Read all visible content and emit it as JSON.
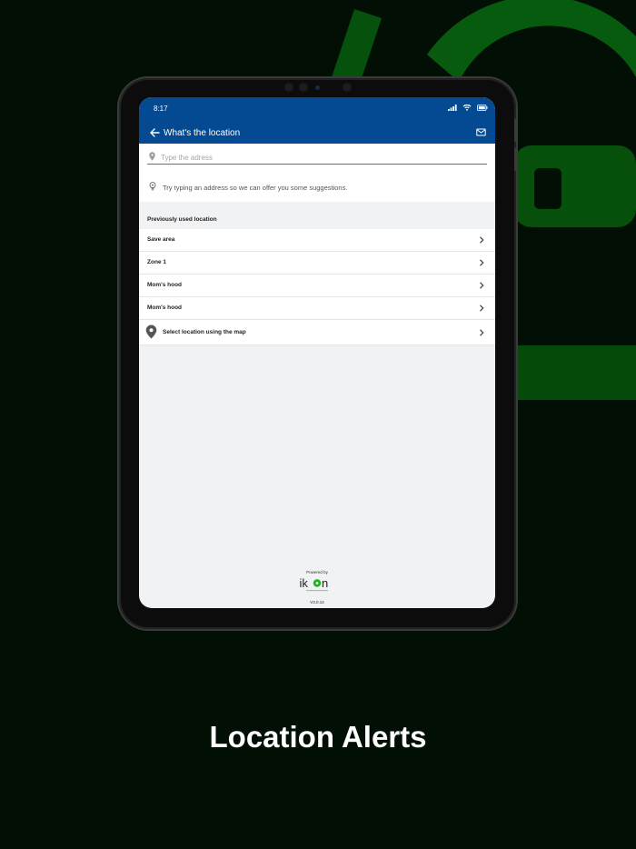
{
  "status_bar": {
    "time": "8:17"
  },
  "app_bar": {
    "title": "What's the location"
  },
  "search": {
    "placeholder": "Type the adress",
    "value": ""
  },
  "tip": {
    "text": "Try typing an address so we can offer you some suggestions."
  },
  "previous": {
    "header": "Previously used location",
    "items": [
      {
        "label": "Save area"
      },
      {
        "label": "Zone 1"
      },
      {
        "label": "Mom's hood"
      },
      {
        "label": "Mom's hood"
      }
    ]
  },
  "map_option": {
    "label": "Select location using the map"
  },
  "footer": {
    "powered_by": "Powered by",
    "brand": "ikon",
    "version": "V3.0.14"
  },
  "caption": "Location Alerts",
  "colors": {
    "app_bar": "#034a93",
    "background": "#020f05",
    "accent_green": "#1db41e",
    "screen_bg": "#f1f2f4"
  },
  "icons": [
    "back-arrow-icon",
    "mail-icon",
    "location-pin-icon",
    "lightbulb-icon",
    "chevron-right-icon",
    "signal-icon",
    "wifi-icon",
    "battery-icon"
  ]
}
